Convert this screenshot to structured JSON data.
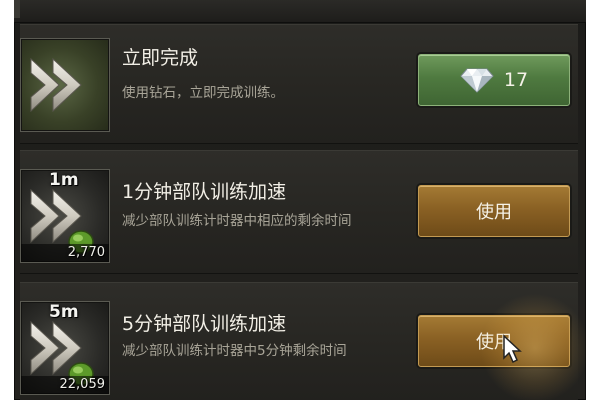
{
  "items": [
    {
      "title": "立即完成",
      "description": "使用钻石，立即完成训练。",
      "button_icon": "diamond-icon",
      "button_label": "17"
    },
    {
      "time": "1m",
      "count": "2,770",
      "title": "1分钟部队训练加速",
      "description": "减少部队训练计时器中相应的剩余时间",
      "button_label": "使用"
    },
    {
      "time": "5m",
      "count": "22,059",
      "title": "5分钟部队训练加速",
      "description": "减少部队训练计时器中5分钟剩余时间",
      "button_label": "使用"
    }
  ],
  "colors": {
    "panel_bg": "#23221f",
    "button_green": "#4f7a40",
    "button_gold": "#8a6124",
    "title_text": "#f2efe6",
    "desc_text": "#a9a598"
  }
}
